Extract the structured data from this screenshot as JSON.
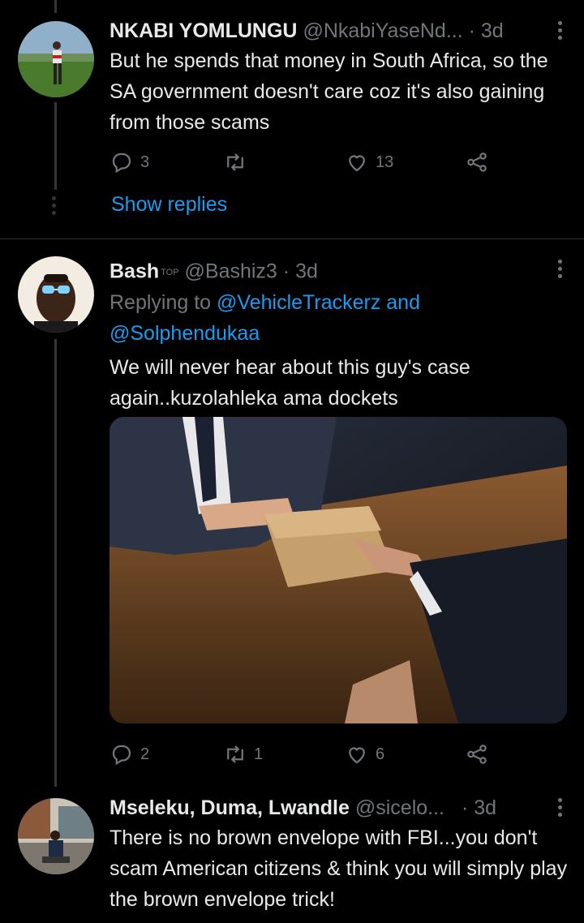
{
  "tweets": [
    {
      "name": "NKABI YOMLUNGU",
      "handle": "@NkabiYaseNd...",
      "time": "· 3d",
      "text": "But he spends that money in South Africa, so the SA government doesn't care coz it's also gaining from those scams",
      "replies": "3",
      "retweets": "",
      "likes": "13",
      "show_replies": "Show replies"
    },
    {
      "name": "Bash",
      "badge": "TOP",
      "handle": "@Bashiz3",
      "time": "· 3d",
      "replying_prefix": "Replying to",
      "replying_to": "@VehicleTrackerz",
      "replying_and": "and",
      "replying_to2": "@Solphendukaa",
      "text": "We will never hear about this guy's case again..kuzolahleka ama dockets",
      "replies": "2",
      "retweets": "1",
      "likes": "6"
    },
    {
      "name": "Mseleku, Duma, Lwandle",
      "handle": "@sicelo...",
      "time": "· 3d",
      "text": "There is no brown envelope with FBI...you don't scam American citizens & think you will simply play the brown envelope trick!"
    }
  ],
  "colors": {
    "background": "#000000",
    "accent": "#1d9bf0",
    "muted": "#71767b",
    "text": "#e7e9ea"
  },
  "icons": [
    "reply-icon",
    "retweet-icon",
    "like-icon",
    "share-icon",
    "more-icon"
  ]
}
